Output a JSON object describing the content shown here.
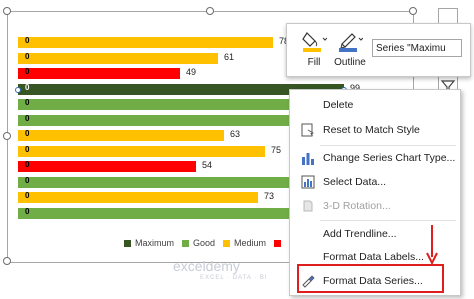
{
  "chart": {
    "bars": [
      {
        "value_label": "78",
        "zero": "0",
        "color": "#ffc000",
        "width": 255
      },
      {
        "value_label": "61",
        "zero": "0",
        "color": "#ffc000",
        "width": 200
      },
      {
        "value_label": "49",
        "zero": "0",
        "color": "#ff0000",
        "width": 162
      },
      {
        "value_label": "99",
        "zero": "0",
        "color": "#375623",
        "width": 326
      },
      {
        "value_label": "",
        "zero": "0",
        "color": "#70ad47",
        "width": 272
      },
      {
        "value_label": "",
        "zero": "0",
        "color": "#70ad47",
        "width": 272
      },
      {
        "value_label": "63",
        "zero": "0",
        "color": "#ffc000",
        "width": 206
      },
      {
        "value_label": "75",
        "zero": "0",
        "color": "#ffc000",
        "width": 247
      },
      {
        "value_label": "54",
        "zero": "0",
        "color": "#ff0000",
        "width": 178
      },
      {
        "value_label": "",
        "zero": "0",
        "color": "#70ad47",
        "width": 272
      },
      {
        "value_label": "73",
        "zero": "0",
        "color": "#ffc000",
        "width": 240
      },
      {
        "value_label": "",
        "zero": "0",
        "color": "#70ad47",
        "width": 272
      }
    ],
    "legend": [
      {
        "label": "Maximum",
        "color": "#375623"
      },
      {
        "label": "Good",
        "color": "#70ad47"
      },
      {
        "label": "Medium",
        "color": "#ffc000"
      },
      {
        "label": "",
        "color": "#ff0000"
      }
    ]
  },
  "toolbar": {
    "fill_label": "Fill",
    "outline_label": "Outline",
    "series_select": "Series \"Maximu"
  },
  "context_menu": {
    "items": [
      {
        "label": "Delete",
        "disabled": false,
        "icon": "delete-icon"
      },
      {
        "label": "Reset to Match Style",
        "disabled": false,
        "icon": "reset-icon"
      },
      {
        "label": "Change Series Chart Type...",
        "disabled": false,
        "icon": "chart-type-icon"
      },
      {
        "label": "Select Data...",
        "disabled": false,
        "icon": "select-data-icon"
      },
      {
        "label": "3-D Rotation...",
        "disabled": true,
        "icon": "rotation-icon"
      },
      {
        "label": "Add Trendline...",
        "disabled": false,
        "icon": ""
      },
      {
        "label": "Format Data Labels...",
        "disabled": false,
        "icon": ""
      },
      {
        "label": "Format Data Series...",
        "disabled": false,
        "icon": "format-series-icon"
      }
    ]
  },
  "watermark": {
    "brand": "exceldemy",
    "tagline": "EXCEL · DATA · BI"
  },
  "colors": {
    "highlight": "#e01e1e",
    "selection": "#2f6fb6"
  }
}
